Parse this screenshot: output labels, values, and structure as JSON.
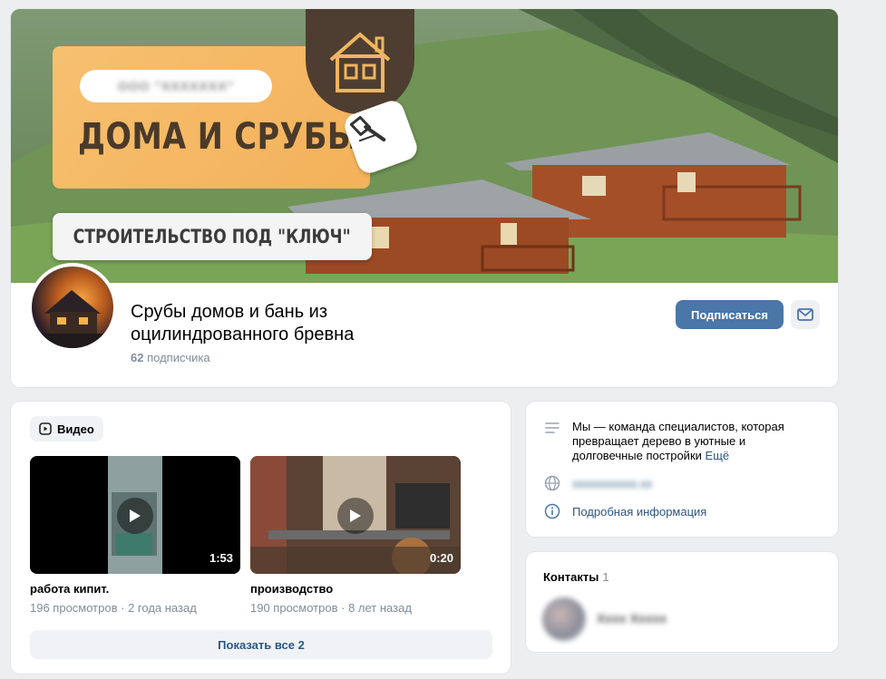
{
  "colors": {
    "accent": "#4a76a8",
    "link": "#2a5885",
    "secondary_text": "#818c99",
    "page_bg": "#edeef0",
    "cover_orange": "#f4b15a",
    "cover_brown": "#4e3e31"
  },
  "cover": {
    "company_label": "ООО \"ХХХХХХХ\"",
    "title": "ДОМА И СРУБЫ",
    "subtitle": "СТРОИТЕЛЬСТВО ПОД \"КЛЮЧ\"",
    "house_icon": "house-icon",
    "axe_icon": "axe-icon"
  },
  "group": {
    "name": "Срубы домов и бань из оцилиндрованного бревна",
    "subscribers_count": "62",
    "subscribers_label": "подписчика",
    "subscribe_label": "Подписаться",
    "message_icon": "envelope-icon"
  },
  "videos": {
    "section_label": "Видео",
    "items": [
      {
        "title": "работа кипит.",
        "views": "196 просмотров",
        "age": "2 года назад",
        "duration": "1:53"
      },
      {
        "title": "производство",
        "views": "190 просмотров",
        "age": "8 лет назад",
        "duration": "0:20"
      }
    ],
    "show_all_label": "Показать все 2"
  },
  "info": {
    "description": "Мы — команда специалистов, которая превращает дерево в уютные и долговечные постройки",
    "more_label": "Ещё",
    "website": "xxxxxxxxxxx.xx",
    "details_label": "Подробная информация"
  },
  "contacts": {
    "title": "Контакты",
    "count": "1",
    "name": "Xxxx Xxxxx"
  }
}
